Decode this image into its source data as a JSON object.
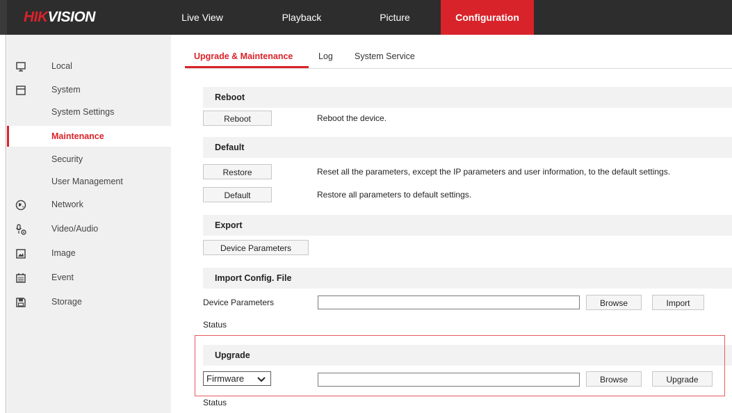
{
  "header": {
    "logo_red": "HIK",
    "logo_white": "VISION",
    "nav": {
      "live_view": "Live View",
      "playback": "Playback",
      "picture": "Picture",
      "configuration": "Configuration"
    }
  },
  "sidebar": {
    "local": "Local",
    "system": "System",
    "system_settings": "System Settings",
    "maintenance": "Maintenance",
    "security": "Security",
    "user_management": "User Management",
    "network": "Network",
    "video_audio": "Video/Audio",
    "image": "Image",
    "event": "Event",
    "storage": "Storage"
  },
  "tabs": {
    "upgrade_maintenance": "Upgrade & Maintenance",
    "log": "Log",
    "system_service": "System Service"
  },
  "reboot": {
    "header": "Reboot",
    "button": "Reboot",
    "desc": "Reboot the device."
  },
  "default": {
    "header": "Default",
    "restore_button": "Restore",
    "restore_desc": "Reset all the parameters, except the IP parameters and user information, to the default settings.",
    "default_button": "Default",
    "default_desc": "Restore all parameters to default settings."
  },
  "export": {
    "header": "Export",
    "device_parameters_button": "Device Parameters"
  },
  "import": {
    "header": "Import Config. File",
    "label": "Device Parameters",
    "file_value": "",
    "browse": "Browse",
    "import": "Import",
    "status": "Status"
  },
  "upgrade": {
    "header": "Upgrade",
    "type_selected": "Firmware",
    "file_value": "",
    "browse": "Browse",
    "upgrade": "Upgrade",
    "status": "Status"
  },
  "colors": {
    "accent": "#d9232a",
    "topbar": "#2d2d2d",
    "sidebar": "#f0f0f0",
    "highlight": "#e8595e"
  }
}
